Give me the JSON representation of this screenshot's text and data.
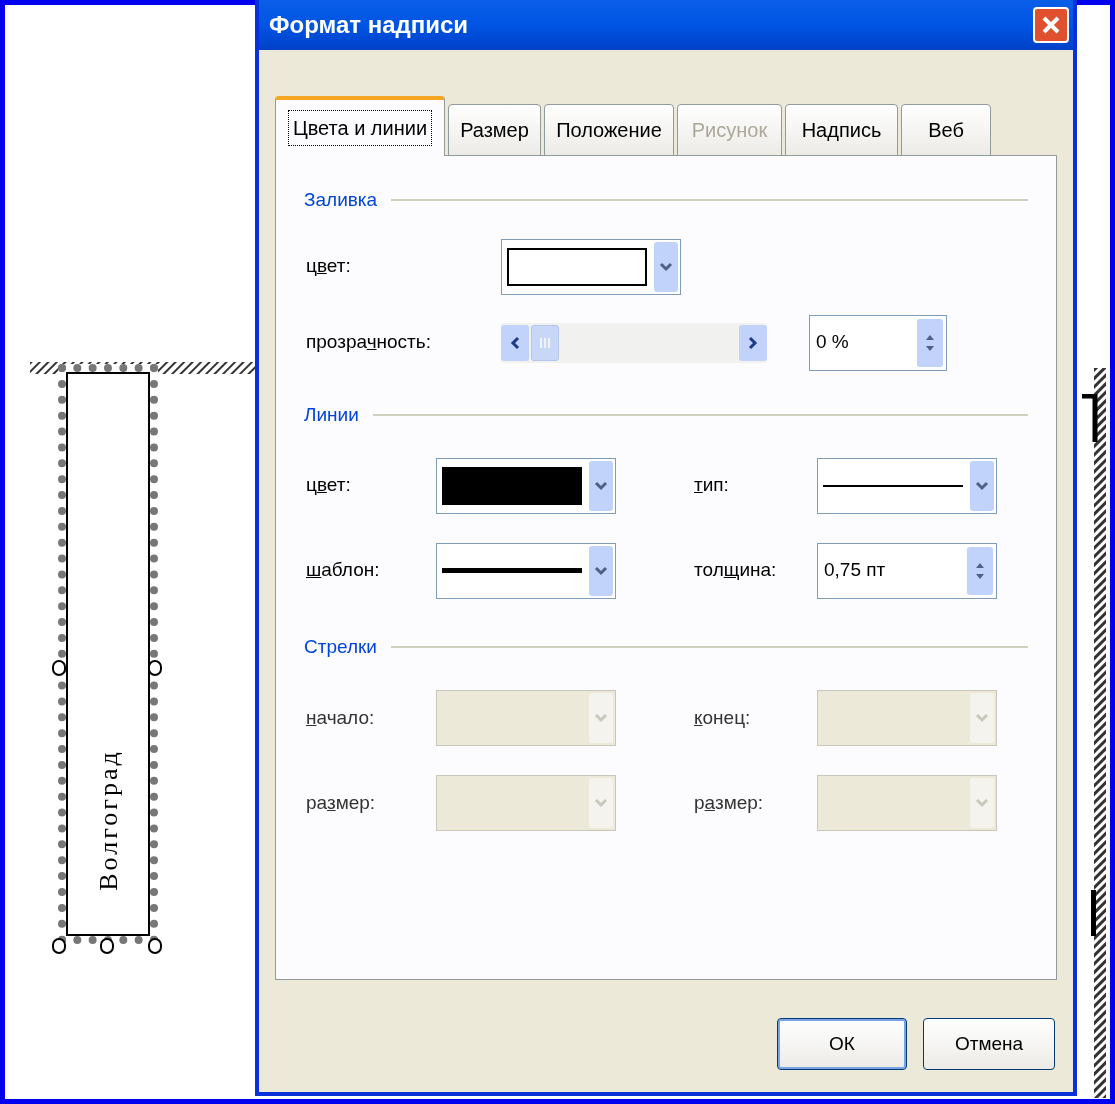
{
  "document": {
    "textbox_text": "Волгоград"
  },
  "window": {
    "title": "Формат надписи"
  },
  "tabs": [
    {
      "label": "Цвета и линии",
      "selected": true,
      "disabled": false
    },
    {
      "label": "Размер",
      "selected": false,
      "disabled": false
    },
    {
      "label": "Положение",
      "selected": false,
      "disabled": false
    },
    {
      "label": "Рисунок",
      "selected": false,
      "disabled": true
    },
    {
      "label": "Надпись",
      "selected": false,
      "disabled": false
    },
    {
      "label": "Веб",
      "selected": false,
      "disabled": false
    }
  ],
  "sections": [
    {
      "title": "Заливка",
      "rows": [
        [
          {
            "label_start": "ц",
            "access_key": "в",
            "label_end": "ет:",
            "kind": "color",
            "color": "#ffffff"
          }
        ],
        [
          {
            "label_start": "прозра",
            "access_key": "ч",
            "label_end": "ность:",
            "kind": "slider",
            "level": 0
          },
          {
            "kind": "spinner",
            "value": "0 %"
          }
        ]
      ]
    },
    {
      "title": "Линии",
      "rows": [
        [
          {
            "label_start": "ц",
            "access_key": "в",
            "label_end": "ет:",
            "kind": "color",
            "color": "#000000"
          },
          {
            "access_key": "т",
            "label_end": "ип:",
            "kind": "linetype"
          }
        ],
        [
          {
            "access_key": "ш",
            "label_end": "аблон:",
            "kind": "pattern"
          },
          {
            "label_start": "тол",
            "access_key": "щ",
            "label_end": "ина:",
            "kind": "spinner",
            "value": "0,75 пт"
          }
        ]
      ]
    },
    {
      "title": "Стрелки",
      "rows": [
        [
          {
            "access_key": "н",
            "label_end": "ачало:",
            "kind": "combo",
            "disabled": true
          },
          {
            "access_key": "к",
            "label_end": "онец:",
            "kind": "combo",
            "disabled": true
          }
        ],
        [
          {
            "label_start": "ра",
            "access_key": "з",
            "label_end": "мер:",
            "kind": "combo",
            "disabled": true
          },
          {
            "label_start": "р",
            "access_key": "а",
            "label_end": "змер:",
            "kind": "combo",
            "disabled": true
          }
        ]
      ]
    }
  ],
  "buttons": [
    "ОК",
    "Отмена"
  ]
}
